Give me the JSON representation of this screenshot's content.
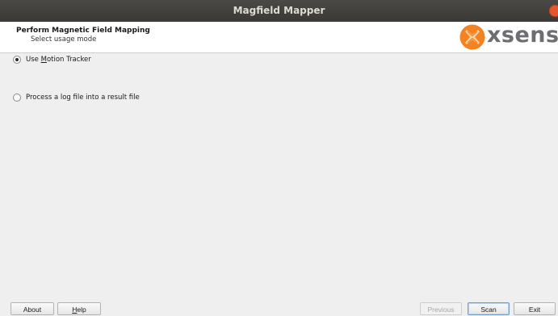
{
  "window": {
    "title": "Magfield Mapper"
  },
  "header": {
    "title": "Perform Magnetic Field Mapping",
    "subtitle": "Select usage mode",
    "logo_text": "xsens"
  },
  "options": [
    {
      "pre": "Use ",
      "mnemonic": "M",
      "post": "otion Tracker",
      "checked": true
    },
    {
      "pre": "Process a log file into a result file",
      "mnemonic": "",
      "post": "",
      "checked": false
    }
  ],
  "footer": {
    "about": "About",
    "help_mnemonic": "H",
    "help_rest": "elp",
    "previous": "Previous",
    "scan": "Scan",
    "exit": "Exit"
  },
  "colors": {
    "titlebar": "#3f3e3a",
    "close": "#e4572e",
    "logo_orange": "#f58220",
    "logo_grey": "#6d6e71"
  }
}
